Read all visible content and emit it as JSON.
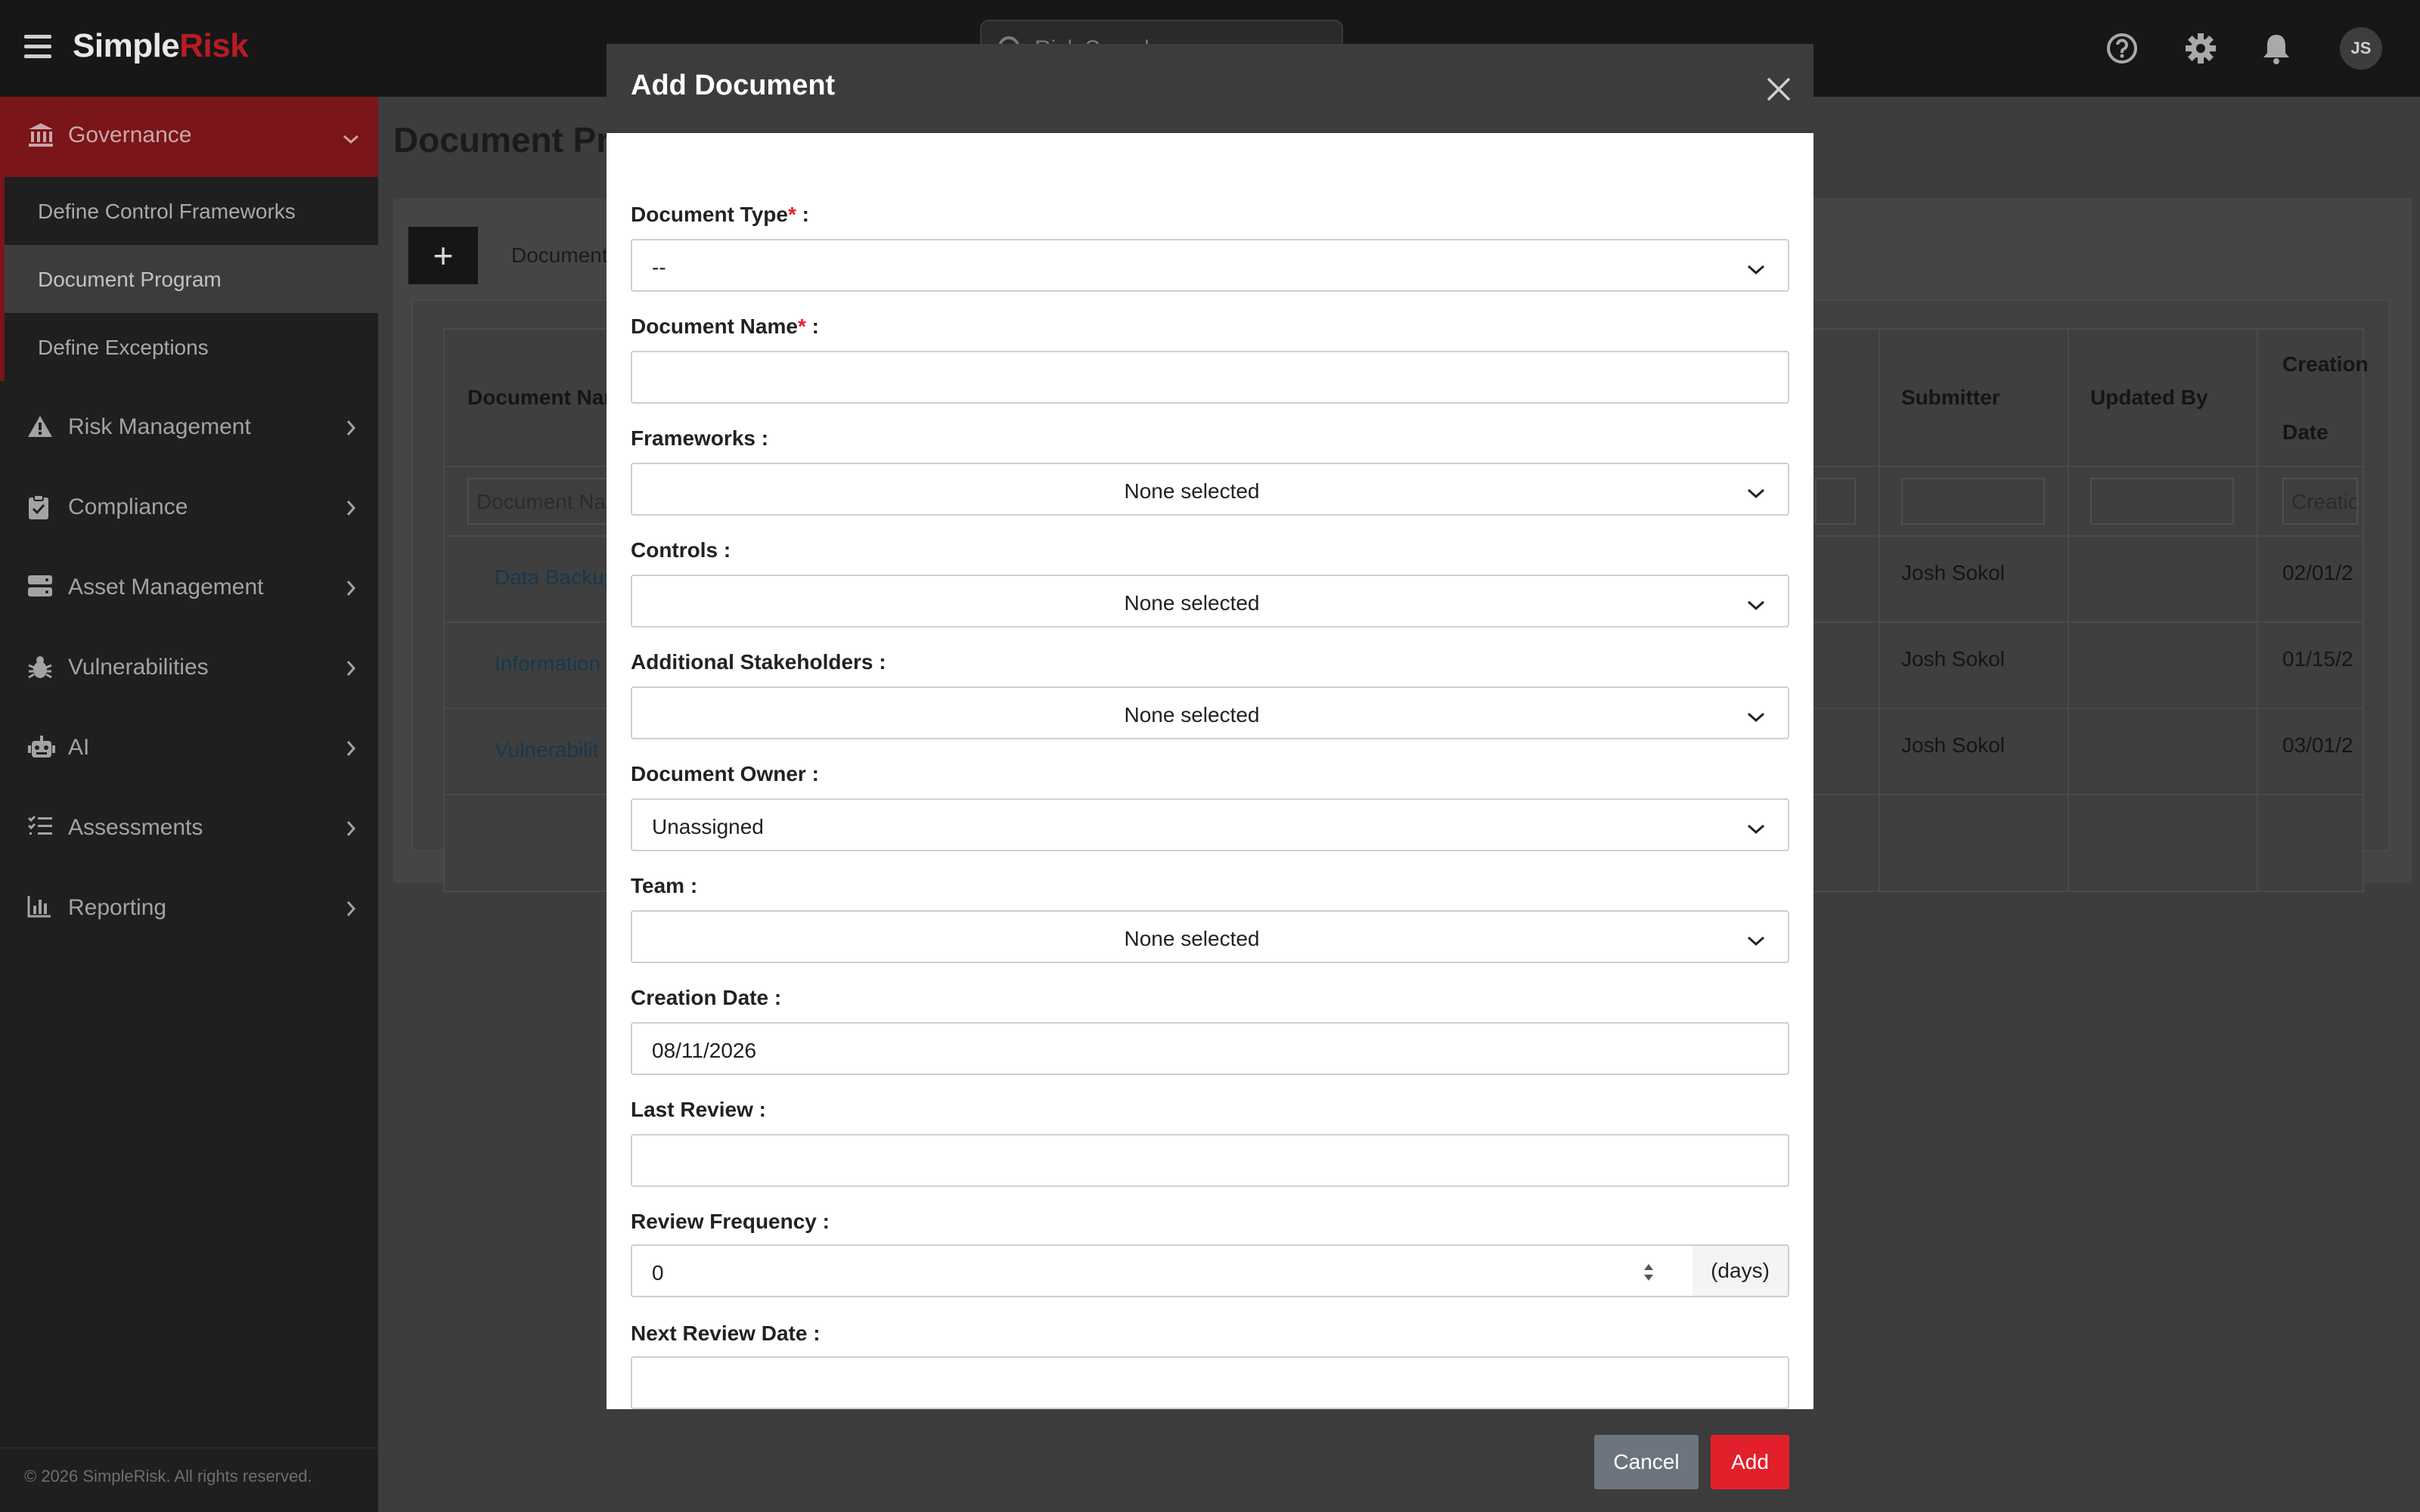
{
  "app": {
    "logo_main": "Simple",
    "logo_accent": "Risk",
    "search_placeholder": "Risk Search",
    "avatar_initials": "JS"
  },
  "sidebar": {
    "governance": "Governance",
    "sub_items": [
      "Define Control Frameworks",
      "Document Program",
      "Define Exceptions"
    ],
    "items": [
      "Risk Management",
      "Compliance",
      "Asset Management",
      "Vulnerabilities",
      "AI",
      "Assessments",
      "Reporting"
    ],
    "copyright": "© 2026 SimpleRisk. All rights reserved."
  },
  "page": {
    "title": "Document Pro",
    "add_label": "+",
    "tab_label": "Document"
  },
  "table": {
    "headers": {
      "doc_name": "Document Nar",
      "submitter": "Submitter",
      "updated_by": "Updated By",
      "creation_line1": "Creation",
      "creation_line2": "Date"
    },
    "filters": {
      "doc_name": "Document Na",
      "creation": "Creatio"
    },
    "rows": [
      {
        "name": "Data Backup",
        "submitter": "Josh Sokol",
        "date": "02/01/2"
      },
      {
        "name": "Information",
        "submitter": "Josh Sokol",
        "date": "01/15/2"
      },
      {
        "name": "Vulnerabilit",
        "submitter": "Josh Sokol",
        "date": "03/01/2"
      }
    ]
  },
  "modal": {
    "title": "Add Document",
    "fields": {
      "doc_type": {
        "label": "Document Type",
        "value": "--"
      },
      "doc_name": {
        "label": "Document Name",
        "value": ""
      },
      "frameworks": {
        "label": "Frameworks :",
        "value": "None selected"
      },
      "controls": {
        "label": "Controls :",
        "value": "None selected"
      },
      "stakeholders": {
        "label": "Additional Stakeholders :",
        "value": "None selected"
      },
      "owner": {
        "label": "Document Owner :",
        "value": "Unassigned"
      },
      "team": {
        "label": "Team :",
        "value": "None selected"
      },
      "creation_date": {
        "label": "Creation Date :",
        "value": "08/11/2026"
      },
      "last_review": {
        "label": "Last Review :",
        "value": ""
      },
      "review_frequency": {
        "label": "Review Frequency :",
        "value": "0",
        "unit": "(days)"
      },
      "next_review": {
        "label": "Next Review Date :",
        "value": ""
      }
    },
    "required_mark": "*",
    "label_suffix": " :",
    "cancel": "Cancel",
    "add": "Add"
  },
  "colors": {
    "accent": "#e2202c",
    "sidebar_active": "#7a1519",
    "header_dark": "#3c3c3c"
  }
}
